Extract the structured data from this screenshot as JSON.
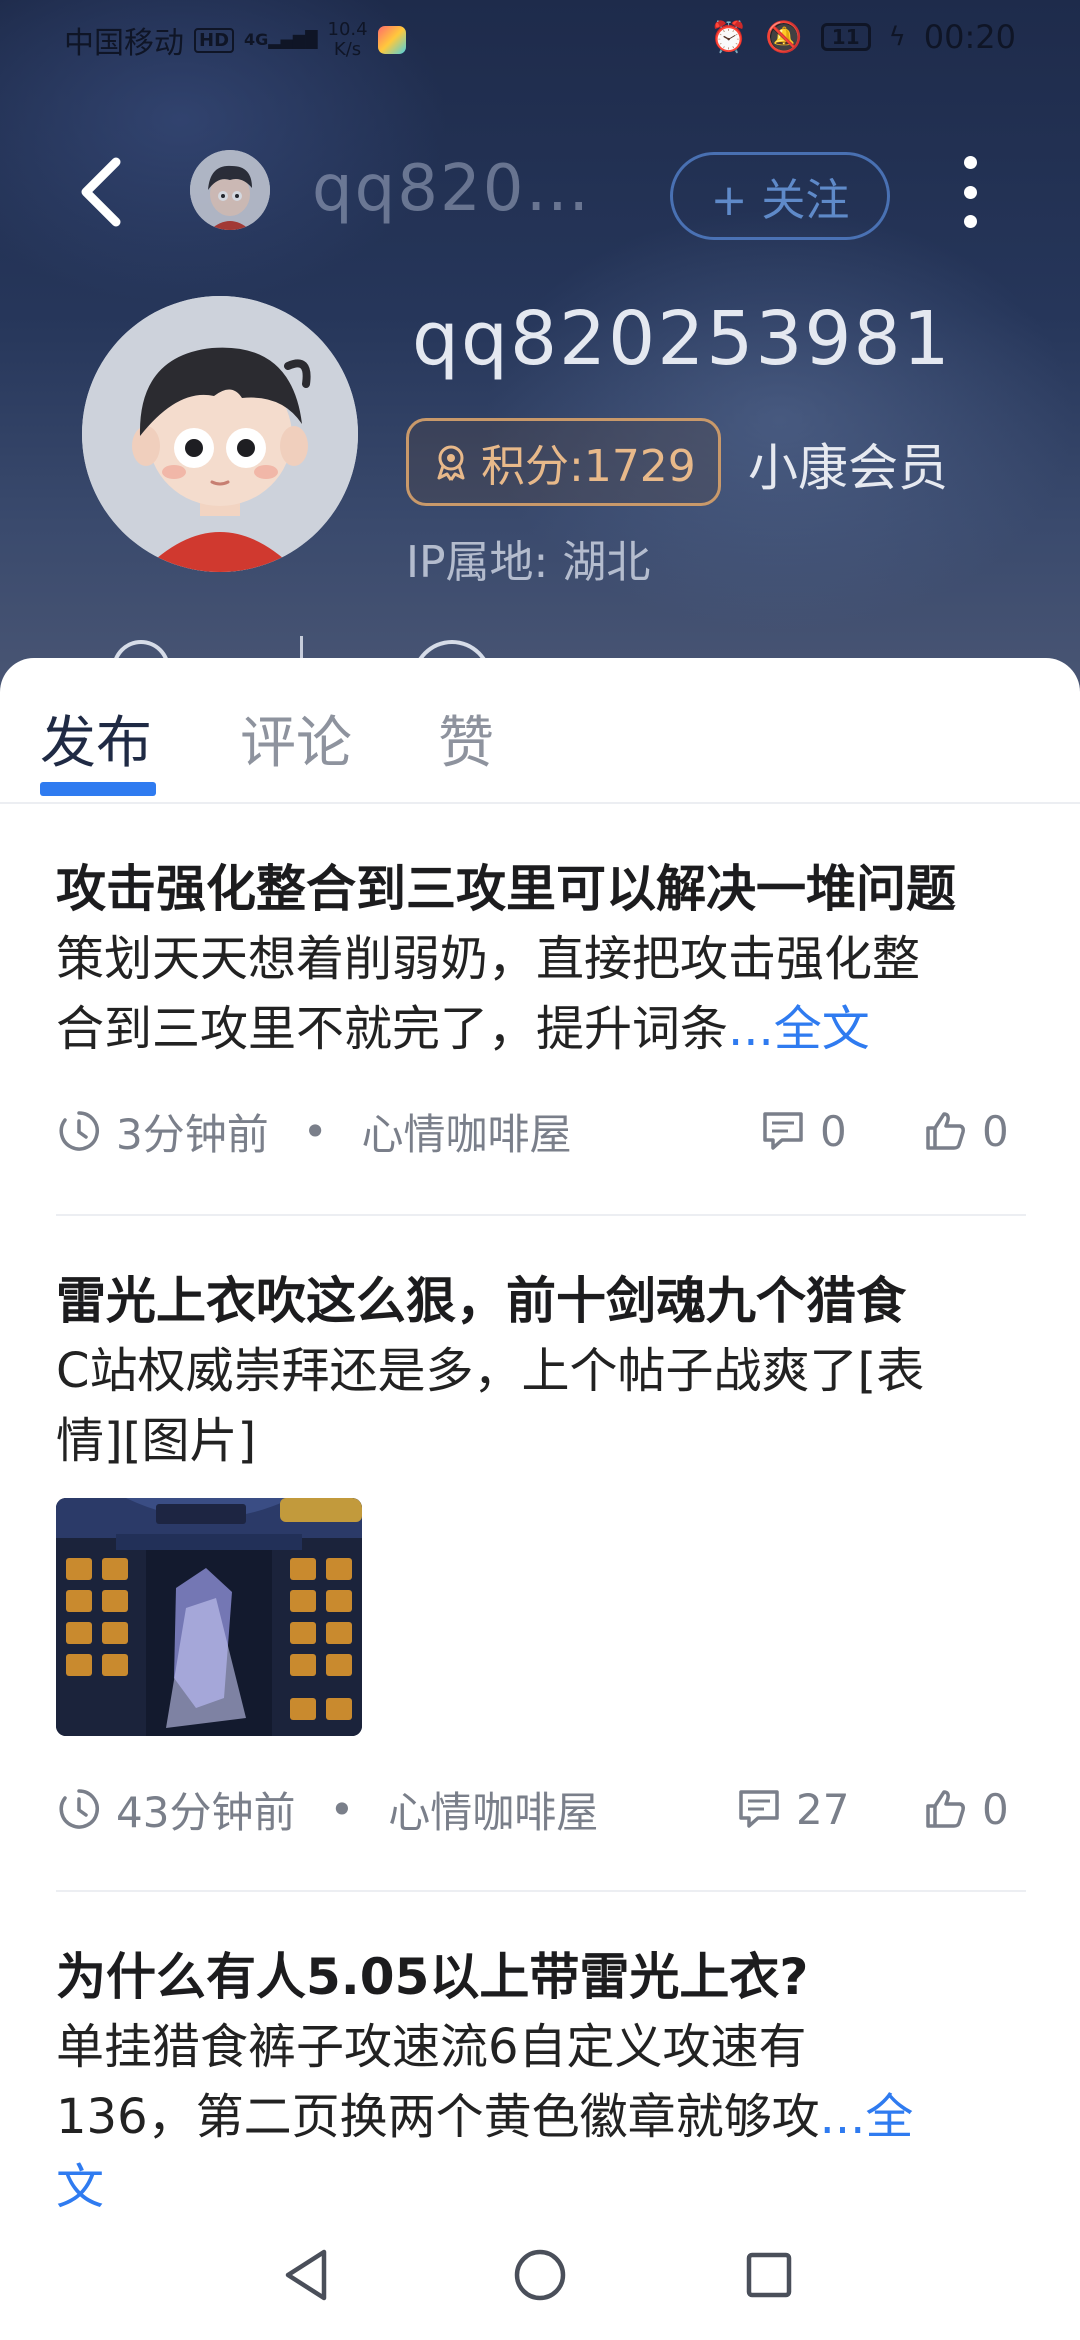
{
  "status_bar": {
    "carrier": "中国移动",
    "hd": "HD",
    "signal": "4G",
    "speed_value": "10.4",
    "speed_unit": "K/s",
    "battery": "11",
    "time": "00:20"
  },
  "header": {
    "title_truncated": "qq820…",
    "follow_label": "+ 关注"
  },
  "profile": {
    "username": "qq820253981",
    "points_label": "积分:1729",
    "member_label": "小康会员",
    "ip_label": "IP属地: 湖北"
  },
  "tabs": [
    {
      "label": "发布",
      "active": true
    },
    {
      "label": "评论",
      "active": false
    },
    {
      "label": "赞",
      "active": false
    }
  ],
  "posts": [
    {
      "title": "攻击强化整合到三攻里可以解决一堆问题",
      "body_line1": "策划天天想着削弱奶，直接把攻击强化整",
      "body_line2": "合到三攻里不就完了，提升词条",
      "ellipsis": "...",
      "full_text_link": "全文",
      "time": "3分钟前",
      "sep": "•",
      "forum": "心情咖啡屋",
      "comments": "0",
      "likes": "0"
    },
    {
      "title": "雷光上衣吹这么狠，前十剑魂九个猎食",
      "body_line1": "C站权威崇拜还是多，上个帖子战爽了[表",
      "body_line2": "情][图片]",
      "time": "43分钟前",
      "sep": "•",
      "forum": "心情咖啡屋",
      "comments": "27",
      "likes": "0"
    },
    {
      "title": "为什么有人5.05以上带雷光上衣?",
      "body_line1": " 单挂猎食裤子攻速流6自定义攻速有",
      "body_line2": "136，第二页换两个黄色徽章就够攻",
      "ellipsis": "...",
      "full_text_link": "全",
      "full_text_link_2": "文"
    }
  ],
  "nav": {
    "back": "back-triangle",
    "home": "home-circle",
    "recents": "recents-square"
  }
}
